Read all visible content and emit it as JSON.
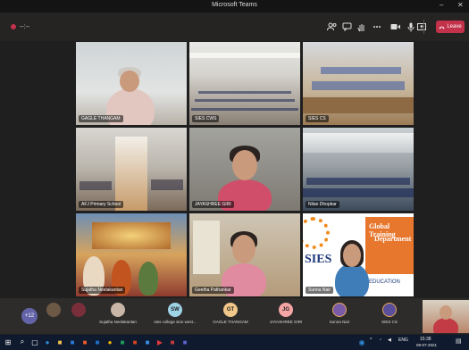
{
  "window": {
    "title": "Microsoft Teams",
    "minimize": "–",
    "close": "✕"
  },
  "toolbar": {
    "meeting_title": "–:–",
    "icons": [
      "participants-icon",
      "chat-icon",
      "raise-hand-icon",
      "more-icon",
      "camera-icon",
      "mic-icon",
      "share-icon"
    ],
    "leave_label": "Leave",
    "leave_color": "#c4314b"
  },
  "tiles": [
    {
      "label": "GAGLE THANGAM"
    },
    {
      "label": "SIES CWS"
    },
    {
      "label": "SIES CS"
    },
    {
      "label": "AFJ Primary School"
    },
    {
      "label": "JAYASHREE GIRI"
    },
    {
      "label": "Nilan Dhopkar"
    },
    {
      "label": "Sujatha Neelakantan"
    },
    {
      "label": "Geetha Pathankar"
    },
    {
      "label": "Sunna Nair"
    }
  ],
  "sies_logo": {
    "brand": "SIES",
    "line1": "Global Training",
    "line2": "Department",
    "line3": "EDUCATION"
  },
  "strip": {
    "more_count": "+12",
    "participants": [
      {
        "name": "Sujatha Neelakantan",
        "initials": "",
        "color": "#c8b6a6"
      },
      {
        "name": "sies college sion west...",
        "initials": "SW",
        "color": "#9fd3e6"
      },
      {
        "name": "GAGLE THANGAM",
        "initials": "GT",
        "color": "#f2c78a"
      },
      {
        "name": "JAYASHREE GIRI",
        "initials": "JG",
        "color": "#f6a5a5"
      },
      {
        "name": "Sunna Nair",
        "initials": "",
        "color": "#7a5ba8"
      },
      {
        "name": "SIES CS",
        "initials": "",
        "color": "#5a4f9a"
      }
    ]
  },
  "taskbar": {
    "language": "ENG",
    "time": "15:38",
    "date": "09-07-2021"
  }
}
